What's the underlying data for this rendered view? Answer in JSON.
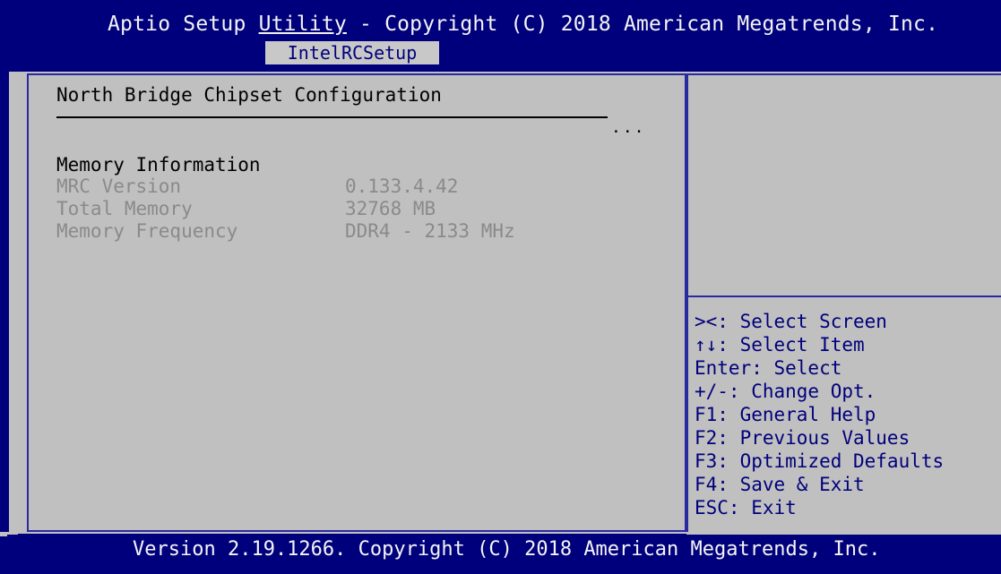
{
  "header": {
    "title_prefix": "Aptio Setup ",
    "title_underlined": "Utility",
    "title_suffix": " - Copyright (C) 2018 American Megatrends, Inc.",
    "active_tab": "IntelRCSetup"
  },
  "main": {
    "section_title": "North Bridge Chipset Configuration",
    "ellipsis": "...",
    "memory_heading": "Memory Information",
    "rows": [
      {
        "label": "MRC Version",
        "value": "0.133.4.42"
      },
      {
        "label": "Total Memory",
        "value": "32768 MB"
      },
      {
        "label": "Memory Frequency",
        "value": "DDR4 - 2133 MHz"
      }
    ]
  },
  "help": {
    "items": [
      "><: Select Screen",
      "↑↓: Select Item",
      "Enter: Select",
      "+/-: Change Opt.",
      "F1: General Help",
      "F2: Previous Values",
      "F3: Optimized Defaults",
      "F4: Save & Exit",
      "ESC: Exit"
    ]
  },
  "footer": {
    "text": "Version 2.19.1266. Copyright (C) 2018 American Megatrends, Inc."
  },
  "colors": {
    "background": "#c0c0c0",
    "header_blue": "#00007c",
    "greyed_text": "#8a8a8a",
    "help_text": "#00007c"
  }
}
